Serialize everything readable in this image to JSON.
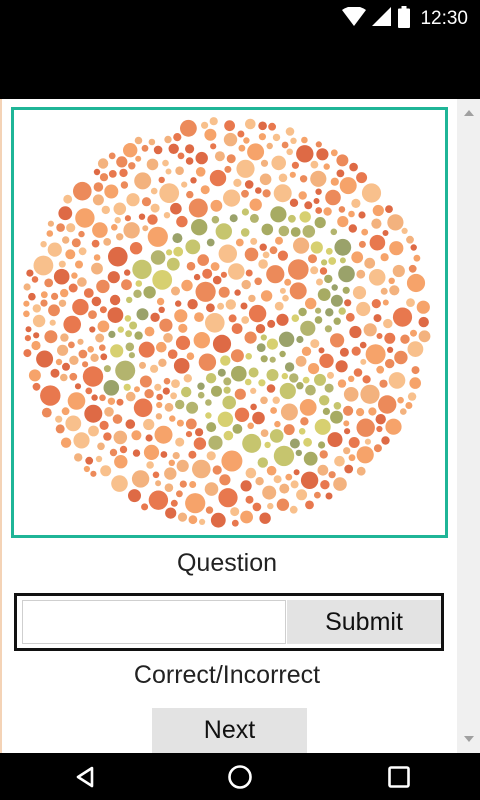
{
  "status_bar": {
    "time": "12:30",
    "icons": [
      "wifi-icon",
      "signal-icon",
      "battery-icon"
    ]
  },
  "plate": {
    "frame_color": "#1fb597",
    "background_colors": [
      "#f6a36a",
      "#e8784e",
      "#f3b27e",
      "#de6a45",
      "#f8c08c",
      "#ec8a5a"
    ],
    "figure_colors": [
      "#a7ab63",
      "#c6c56e",
      "#9aa26a",
      "#d7d070",
      "#b3b46e"
    ]
  },
  "question": {
    "label": "Question"
  },
  "answer": {
    "input_value": "",
    "input_placeholder": "",
    "submit_label": "Submit"
  },
  "result": {
    "label": "Correct/Incorrect"
  },
  "next": {
    "label": "Next"
  },
  "nav_bar": {
    "icons": [
      "back-icon",
      "home-icon",
      "recents-icon"
    ]
  }
}
